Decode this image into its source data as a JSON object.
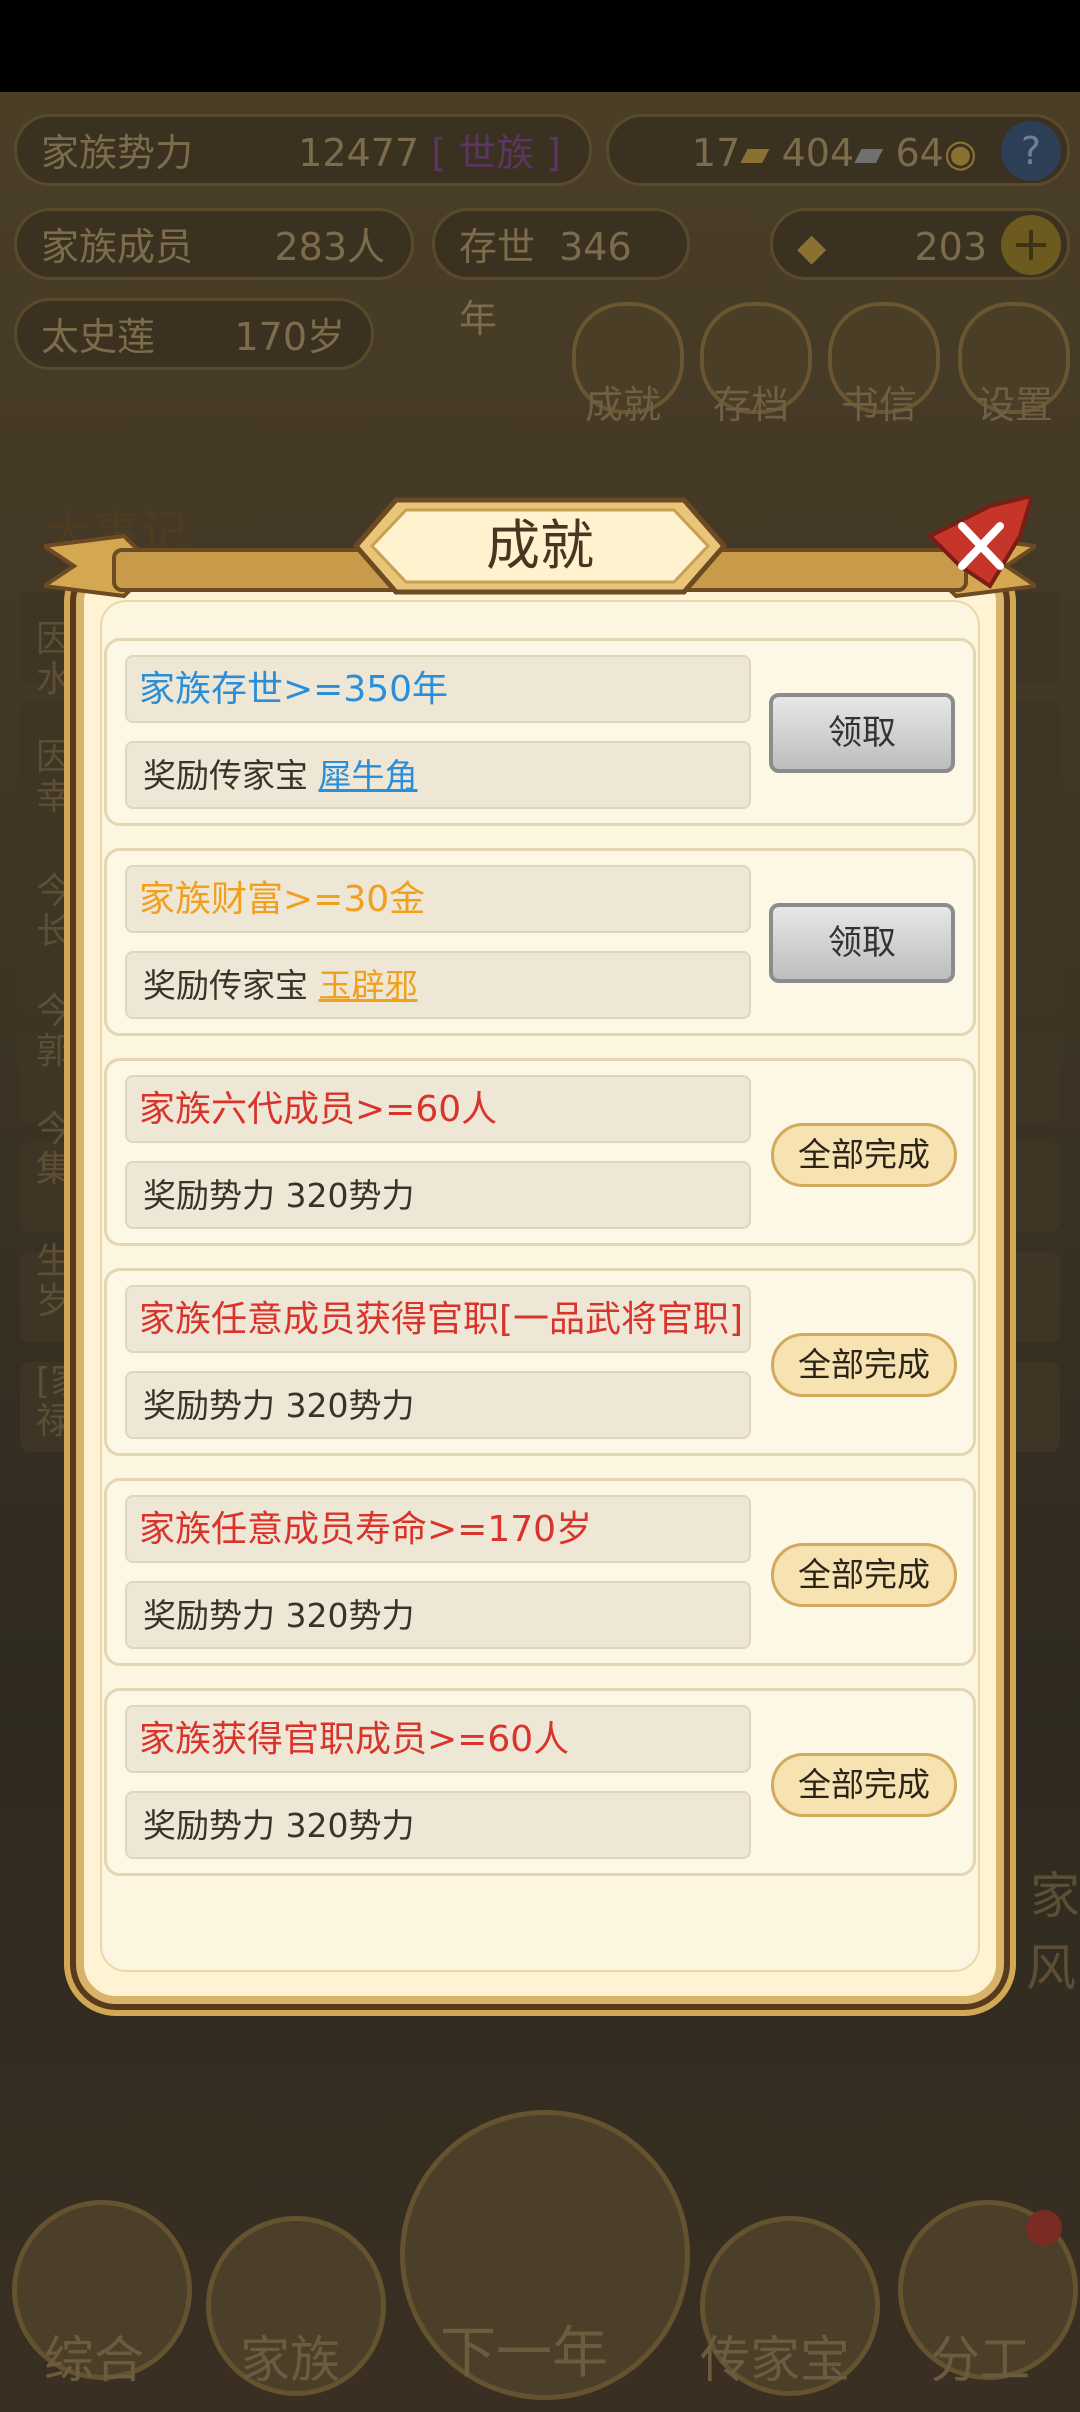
{
  "background": {
    "stats": {
      "power_label": "家族势力",
      "power_value": "12477",
      "power_rank": "[ 世族 ]",
      "res_gold": "17",
      "res_silver": "404",
      "res_coin": "64",
      "members_label": "家族成员",
      "members_value": "283人",
      "age_label": "存世",
      "age_value": "346年",
      "ingot_value": "203",
      "elder_name": "太史莲",
      "elder_age": "170岁"
    },
    "menu": [
      "成就",
      "存档",
      "书信",
      "设置"
    ],
    "events_title": "大事记",
    "event_fragments": [
      "因",
      "水",
      "因",
      "幸",
      "今",
      "长",
      "今",
      "郭",
      "今",
      "集",
      "生",
      "岁",
      "[家",
      "禄"
    ],
    "right_fragments": [
      "家",
      "风"
    ],
    "nav": [
      "综合",
      "家族",
      "下一年",
      "传家宝",
      "分工"
    ],
    "colors": {
      "dim_text": "#7d6c4c"
    }
  },
  "modal": {
    "title": "成就",
    "achievements": [
      {
        "condition": "家族存世>=350年",
        "reward_prefix": "奖励传家宝 ",
        "reward_item": "犀牛角",
        "action": "领取",
        "color": "#2a8fd8"
      },
      {
        "condition": "家族财富>=30金",
        "reward_prefix": "奖励传家宝 ",
        "reward_item": "玉辟邪",
        "action": "领取",
        "color": "#f0a01e"
      },
      {
        "condition": "家族六代成员>=60人",
        "reward_prefix": "奖励势力 320势力",
        "action": "全部完成",
        "color": "#d9342b"
      },
      {
        "condition": "家族任意成员获得官职[一品武将官职]",
        "reward_prefix": "奖励势力 320势力",
        "action": "全部完成",
        "color": "#d9342b"
      },
      {
        "condition": "家族任意成员寿命>=170岁",
        "reward_prefix": "奖励势力 320势力",
        "action": "全部完成",
        "color": "#d9342b"
      },
      {
        "condition": "家族获得官职成员>=60人",
        "reward_prefix": "奖励势力 320势力",
        "action": "全部完成",
        "color": "#d9342b"
      }
    ]
  }
}
